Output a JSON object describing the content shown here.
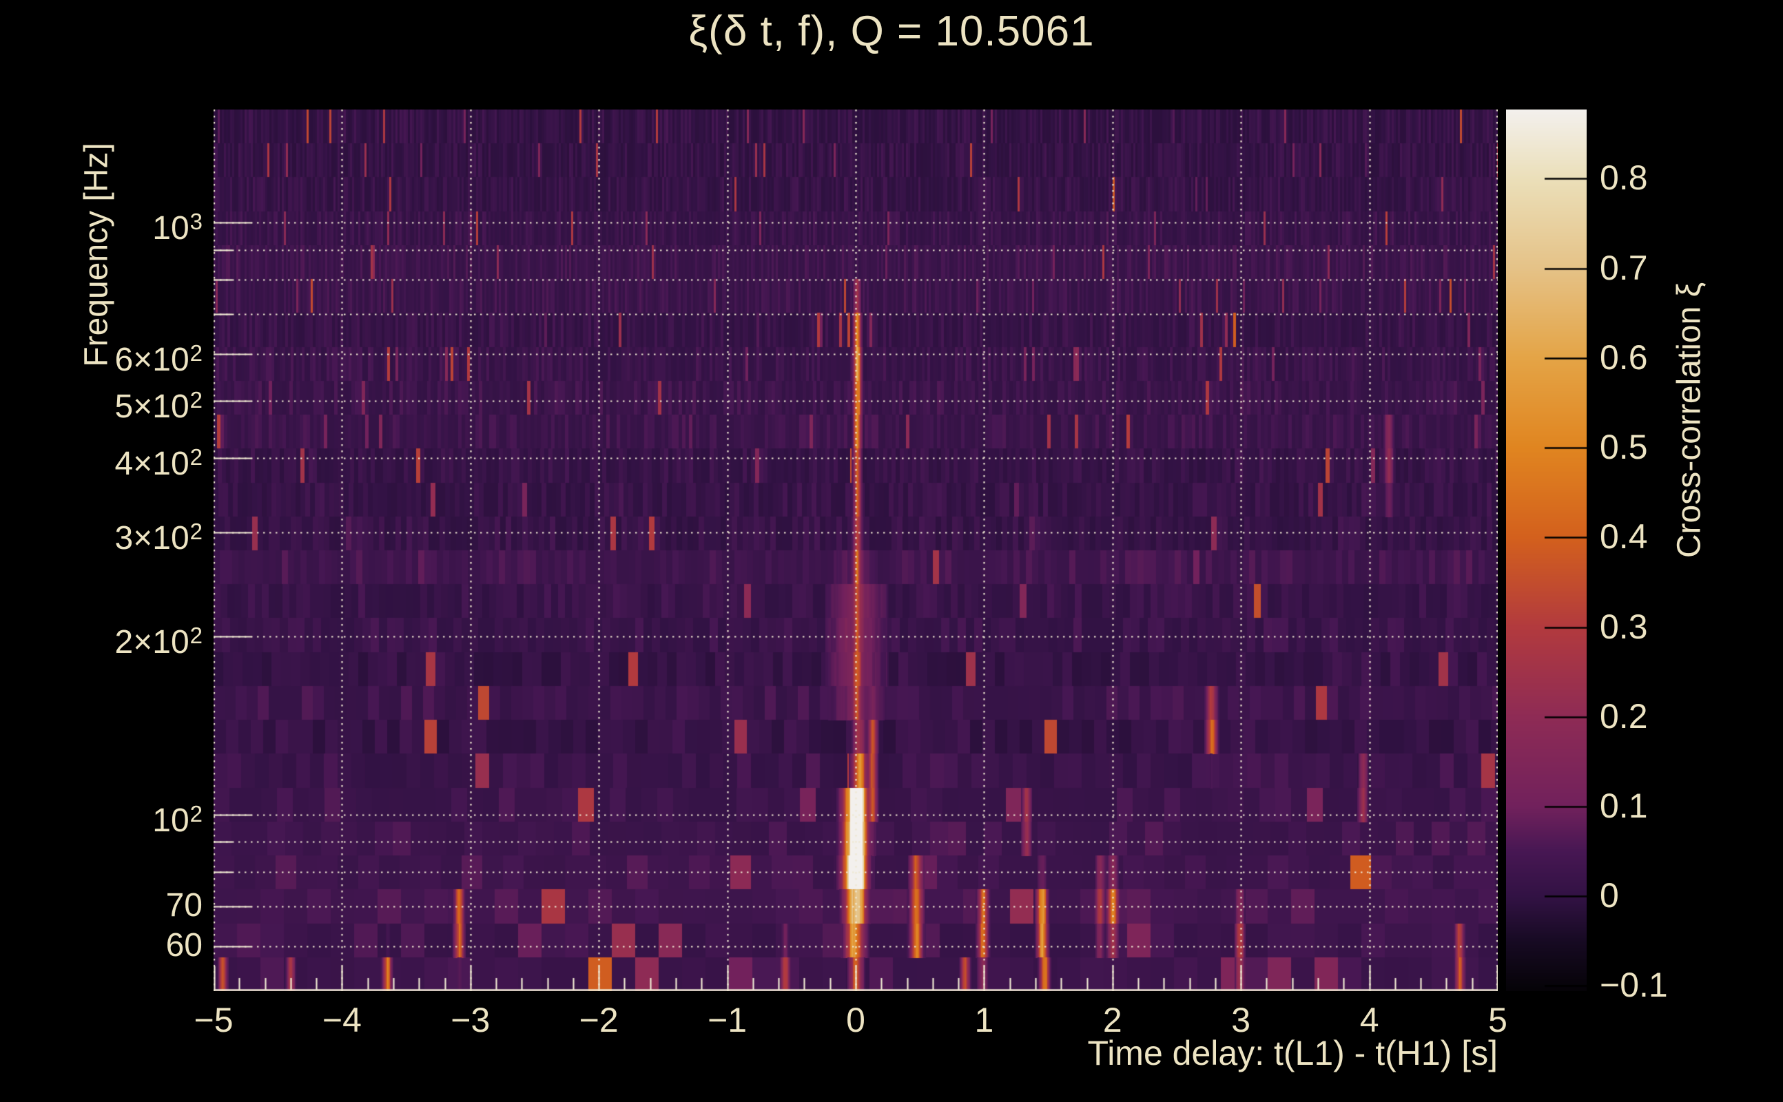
{
  "figure": {
    "title": "ξ(δ t, f), Q = 10.5061",
    "background_color": "#000000",
    "text_color": "#ede4c3"
  },
  "chart_data": {
    "type": "heatmap",
    "title": "ξ(δ t, f), Q = 10.5061",
    "xlabel": "Time delay: t(L1) - t(H1) [s]",
    "ylabel": "Frequency [Hz]",
    "colorbar_label": "Cross-correlation ξ",
    "x_range": [
      -5,
      5
    ],
    "y_range_hz": [
      50.4,
      1552
    ],
    "y_scale": "log",
    "value_range": [
      -0.105,
      0.877
    ],
    "grid": {
      "style": "dotted",
      "color": "#efe8d2"
    },
    "x_ticks": [
      {
        "value": -5,
        "label": "−5"
      },
      {
        "value": -4,
        "label": "−4"
      },
      {
        "value": -3,
        "label": "−3"
      },
      {
        "value": -2,
        "label": "−2"
      },
      {
        "value": -1,
        "label": "−1"
      },
      {
        "value": 0,
        "label": "0"
      },
      {
        "value": 1,
        "label": "1"
      },
      {
        "value": 2,
        "label": "2"
      },
      {
        "value": 3,
        "label": "3"
      },
      {
        "value": 4,
        "label": "4"
      },
      {
        "value": 5,
        "label": "5"
      }
    ],
    "x_minor_tick_step": 0.2,
    "y_ticks": [
      {
        "f": 1000,
        "base": "10",
        "sup": "3",
        "major": true
      },
      {
        "f": 900,
        "major": false
      },
      {
        "f": 800,
        "major": false
      },
      {
        "f": 700,
        "major": false
      },
      {
        "f": 600,
        "base": "6×10",
        "sup": "2",
        "major": true
      },
      {
        "f": 500,
        "base": "5×10",
        "sup": "2",
        "major": true
      },
      {
        "f": 400,
        "base": "4×10",
        "sup": "2",
        "major": true
      },
      {
        "f": 300,
        "base": "3×10",
        "sup": "2",
        "major": true
      },
      {
        "f": 200,
        "base": "2×10",
        "sup": "2",
        "major": true
      },
      {
        "f": 100,
        "base": "10",
        "sup": "2",
        "major": true
      },
      {
        "f": 90,
        "major": false
      },
      {
        "f": 80,
        "major": false
      },
      {
        "f": 70,
        "base": "70",
        "major": true
      },
      {
        "f": 60,
        "base": "60",
        "major": true
      }
    ],
    "colorbar_ticks": [
      {
        "value": 0.8,
        "label": "0.8"
      },
      {
        "value": 0.7,
        "label": "0.7"
      },
      {
        "value": 0.6,
        "label": "0.6"
      },
      {
        "value": 0.5,
        "label": "0.5"
      },
      {
        "value": 0.4,
        "label": "0.4"
      },
      {
        "value": 0.3,
        "label": "0.3"
      },
      {
        "value": 0.2,
        "label": "0.2"
      },
      {
        "value": 0.1,
        "label": "0.1"
      },
      {
        "value": 0.0,
        "label": "0"
      },
      {
        "value": -0.1,
        "label": "−0.1"
      }
    ],
    "colormap": [
      [
        -0.105,
        "#050307"
      ],
      [
        -0.05,
        "#170a23"
      ],
      [
        0.0,
        "#321244"
      ],
      [
        0.05,
        "#471753"
      ],
      [
        0.1,
        "#71215c"
      ],
      [
        0.2,
        "#8e2b55"
      ],
      [
        0.3,
        "#b23a3e"
      ],
      [
        0.4,
        "#d3601d"
      ],
      [
        0.5,
        "#e08520"
      ],
      [
        0.6,
        "#e4a446"
      ],
      [
        0.7,
        "#e5c287"
      ],
      [
        0.8,
        "#ebdfb9"
      ],
      [
        0.877,
        "#f3f0ed"
      ]
    ],
    "noise": {
      "rows": 26,
      "seed": 42,
      "base_level": 0.0,
      "base_jitter": 0.03,
      "texture_amp": 0.055,
      "low_band_boost_hz": [
        57,
        76
      ],
      "low_band_boost": 0.015,
      "streak_prob_low": 0.1,
      "streak_prob_mid": 0.05,
      "streak_prob_high": 0.02,
      "streak_amp": 0.32,
      "block_width_k": 2400,
      "block_width_min": 3,
      "block_width_max": 34
    },
    "features": [
      {
        "name": "central-needle-core",
        "dt": 0.01,
        "sigma_t": 0.018,
        "f_lo": 430,
        "f_hi": 680,
        "amp": 0.52
      },
      {
        "name": "central-needle-low",
        "dt": 0.01,
        "sigma_t": 0.018,
        "f_lo": 250,
        "f_hi": 430,
        "amp": 0.34
      },
      {
        "name": "central-needle-high",
        "dt": 0.01,
        "sigma_t": 0.016,
        "f_lo": 680,
        "f_hi": 800,
        "amp": 0.22
      },
      {
        "name": "central-needle-mid",
        "dt": 0.01,
        "sigma_t": 0.02,
        "f_lo": 135,
        "f_hi": 250,
        "amp": 0.22
      },
      {
        "name": "central-blob-core",
        "dt": -0.015,
        "sigma_t": 0.05,
        "f_lo": 74,
        "f_hi": 110,
        "amp": 0.95
      },
      {
        "name": "central-blob-upper",
        "dt": 0.03,
        "sigma_t": 0.032,
        "f_lo": 70,
        "f_hi": 132,
        "amp": 0.5
      },
      {
        "name": "central-blob-lower",
        "dt": -0.01,
        "sigma_t": 0.045,
        "f_lo": 58,
        "f_hi": 78,
        "amp": 0.55
      },
      {
        "name": "central-blob-tail",
        "dt": 0.0,
        "sigma_t": 0.03,
        "f_lo": 50,
        "f_hi": 58,
        "amp": 0.35
      },
      {
        "name": "halo-200hz",
        "dt": 0.0,
        "sigma_t": 0.13,
        "f_lo": 150,
        "f_hi": 260,
        "amp": 0.11
      },
      {
        "name": "side-needle",
        "dt": 0.13,
        "sigma_t": 0.02,
        "f_lo": 95,
        "f_hi": 148,
        "amp": 0.32
      },
      {
        "name": "spot-p0p47",
        "dt": 0.47,
        "sigma_t": 0.028,
        "f_lo": 58,
        "f_hi": 82,
        "amp": 0.5
      },
      {
        "name": "spot-p0p99",
        "dt": 0.99,
        "sigma_t": 0.022,
        "f_lo": 55,
        "f_hi": 75,
        "amp": 0.42
      },
      {
        "name": "spot-p0p85-bottom",
        "dt": 0.85,
        "sigma_t": 0.02,
        "f_lo": 50,
        "f_hi": 57,
        "amp": 0.42
      },
      {
        "name": "spot-p1p33",
        "dt": 1.33,
        "sigma_t": 0.02,
        "f_lo": 85,
        "f_hi": 112,
        "amp": 0.22
      },
      {
        "name": "spot-p1p45",
        "dt": 1.45,
        "sigma_t": 0.024,
        "f_lo": 57,
        "f_hi": 76,
        "amp": 0.55
      },
      {
        "name": "spot-p1p47-bottom",
        "dt": 1.47,
        "sigma_t": 0.02,
        "f_lo": 50,
        "f_hi": 57,
        "amp": 0.5
      },
      {
        "name": "spot-p1p9",
        "dt": 1.9,
        "sigma_t": 0.02,
        "f_lo": 62,
        "f_hi": 80,
        "amp": 0.3
      },
      {
        "name": "spot-p2p0",
        "dt": 2.0,
        "sigma_t": 0.024,
        "f_lo": 62,
        "f_hi": 78,
        "amp": 0.5
      },
      {
        "name": "spot-p2p77",
        "dt": 2.77,
        "sigma_t": 0.024,
        "f_lo": 126,
        "f_hi": 158,
        "amp": 0.42
      },
      {
        "name": "spot-p2p99",
        "dt": 2.99,
        "sigma_t": 0.02,
        "f_lo": 52,
        "f_hi": 70,
        "amp": 0.3
      },
      {
        "name": "spot-p3p95",
        "dt": 3.95,
        "sigma_t": 0.02,
        "f_lo": 100,
        "f_hi": 122,
        "amp": 0.25
      },
      {
        "name": "streak-p4p15-400hz",
        "dt": 4.15,
        "sigma_t": 0.02,
        "f_lo": 345,
        "f_hi": 470,
        "amp": 0.17
      },
      {
        "name": "spot-p4p7",
        "dt": 4.7,
        "sigma_t": 0.02,
        "f_lo": 50,
        "f_hi": 64,
        "amp": 0.35
      },
      {
        "name": "spot-m0p55-bottom",
        "dt": -0.55,
        "sigma_t": 0.02,
        "f_lo": 50,
        "f_hi": 60,
        "amp": 0.3
      },
      {
        "name": "spot-m3p09",
        "dt": -3.09,
        "sigma_t": 0.022,
        "f_lo": 57,
        "f_hi": 74,
        "amp": 0.4
      },
      {
        "name": "spot-m3p65-bottom",
        "dt": -3.65,
        "sigma_t": 0.02,
        "f_lo": 50,
        "f_hi": 58,
        "amp": 0.45
      },
      {
        "name": "spot-m4p4-bottom",
        "dt": -4.4,
        "sigma_t": 0.018,
        "f_lo": 50,
        "f_hi": 58,
        "amp": 0.3
      },
      {
        "name": "spot-m4p93-bottom",
        "dt": -4.93,
        "sigma_t": 0.018,
        "f_lo": 50,
        "f_hi": 57,
        "amp": 0.4
      }
    ]
  }
}
